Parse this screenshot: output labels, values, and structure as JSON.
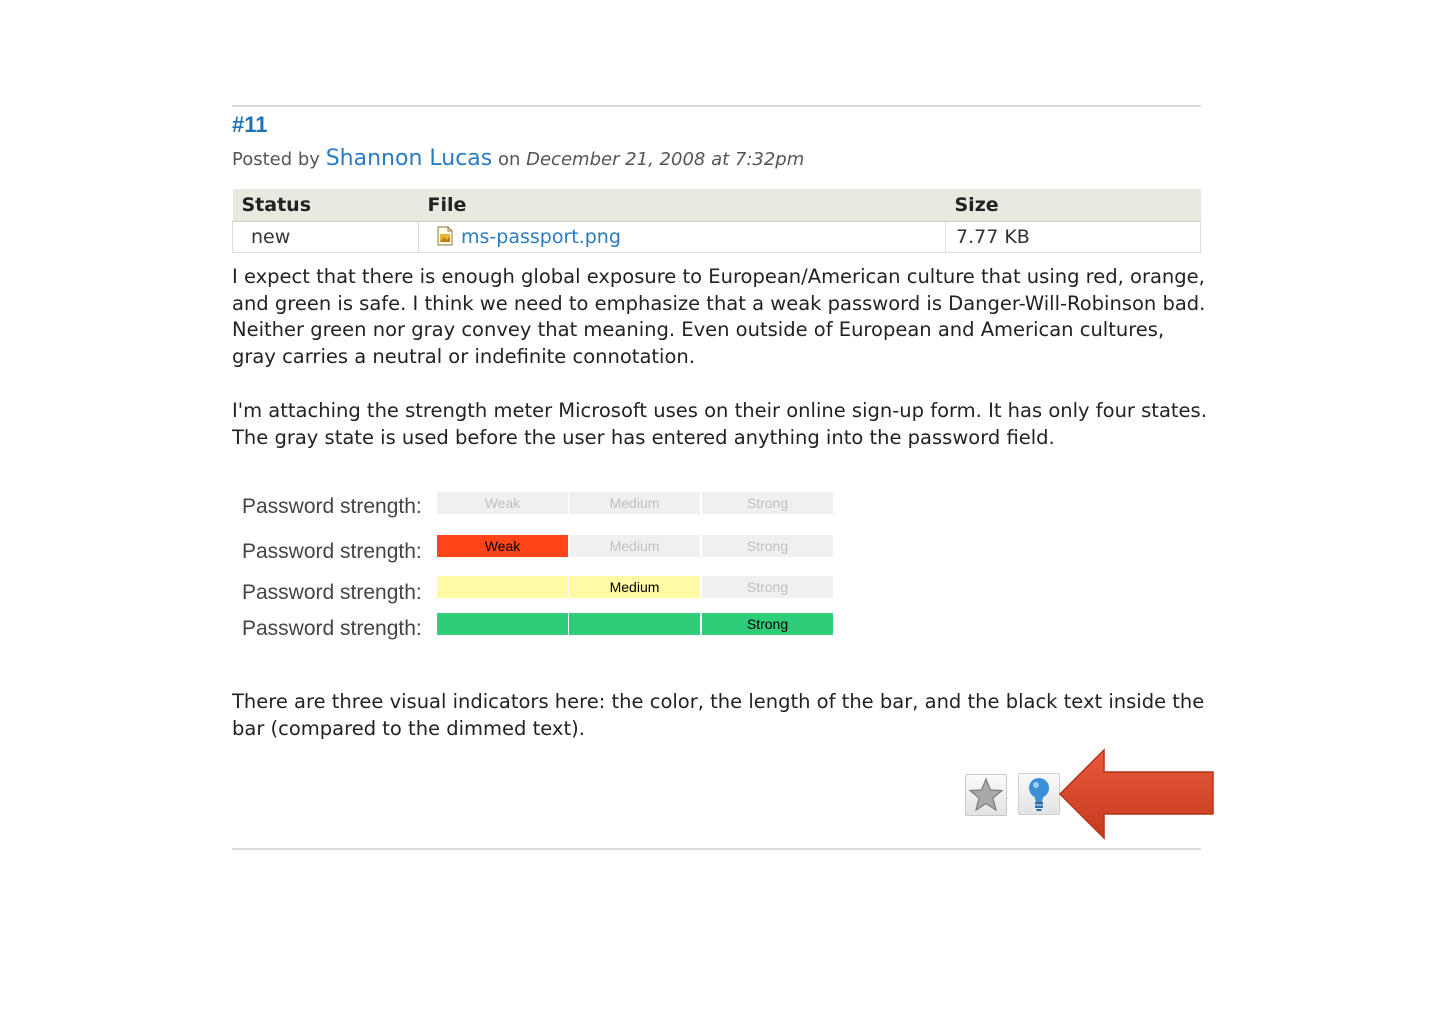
{
  "comment": {
    "number": "#11",
    "posted_by_prefix": "Posted by",
    "author": "Shannon Lucas",
    "on_word": "on",
    "date": "December 21, 2008 at 7:32pm"
  },
  "attachments": {
    "headers": [
      "Status",
      "File",
      "Size"
    ],
    "rows": [
      {
        "status": "new",
        "file": "ms-passport.png",
        "size": "7.77 KB"
      }
    ]
  },
  "body": {
    "p1": "I expect that there is enough global exposure to European/American culture that using red, orange, and green is safe. I think we need to emphasize that a weak password is Danger-Will-Robinson bad. Neither green nor gray convey that meaning. Even outside of European and American cultures, gray carries a neutral or indefinite connotation.",
    "p2": "I'm attaching the strength meter Microsoft uses on their online sign-up form. It has only four states. The gray state is used before the user has entered anything into the password field.",
    "p3": "There are three visual indicators here: the color, the length of the bar, and the black text inside the bar (compared to the dimmed text)."
  },
  "meters": [
    {
      "label": "Password strength:",
      "weak": "Weak",
      "medium": "Medium",
      "strong": "Strong"
    },
    {
      "label": "Password strength:",
      "weak": "Weak",
      "medium": "Medium",
      "strong": "Strong"
    },
    {
      "label": "Password strength:",
      "weak": "",
      "medium": "Medium",
      "strong": "Strong"
    },
    {
      "label": "Password strength:",
      "weak": "",
      "medium": "",
      "strong": "Strong"
    }
  ],
  "colors": {
    "link": "#2a7bc1",
    "weak": "#ff4419",
    "medium": "#fffaa5",
    "strong": "#2fcd7a",
    "inactive": "#f0f0f0",
    "arrow": "#d9452a"
  },
  "actions": {
    "star_icon": "star-icon",
    "bulb_icon": "lightbulb-icon"
  }
}
